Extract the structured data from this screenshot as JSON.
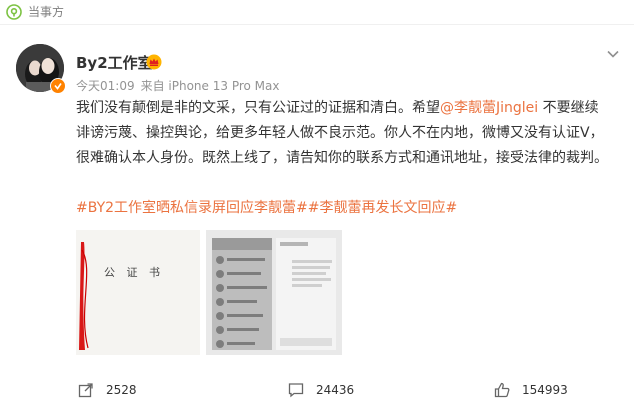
{
  "source_label": "当事方",
  "user": {
    "name": "By2工作室"
  },
  "meta": {
    "time": "今天01:09",
    "source": "来自 iPhone 13 Pro Max"
  },
  "post": {
    "text_part1": "我们没有颠倒是非的文采，只有公证过的证据和清白。希望",
    "mention": "@李靓蕾Jinglei",
    "text_part2": " 不要继续诽谤污蔑、操控舆论，给更多年轻人做不良示范。你人不在内地，微博又没有认证V，很难确认本人身份。既然上线了，请告知你的联系方式和通讯地址，接受法律的裁判。",
    "hashtags": "#BY2工作室晒私信录屏回应李靓蕾##李靓蕾再发长文回应#"
  },
  "images": {
    "notary_title": "公 证 书"
  },
  "actions": {
    "share_count": "2528",
    "comment_count": "24436",
    "like_count": "154993"
  },
  "colors": {
    "link": "#eb7340",
    "meta": "#939393",
    "verified": "#ff8200"
  }
}
